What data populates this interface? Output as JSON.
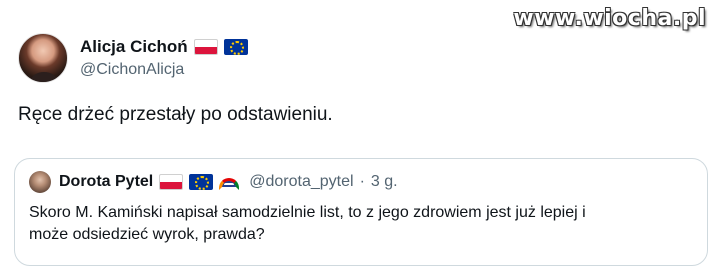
{
  "watermark": "www.wiocha.pl",
  "tweet": {
    "author": {
      "display_name": "Alicja Cichoń",
      "handle": "@CichonAlicja",
      "badges": [
        "flag-poland-icon",
        "flag-eu-icon"
      ]
    },
    "text": "Ręce drżeć przestały po odstawieniu."
  },
  "quoted_tweet": {
    "author": {
      "display_name": "Dorota Pytel",
      "handle": "@dorota_pytel",
      "badges": [
        "flag-poland-icon",
        "flag-eu-icon",
        "rainbow-icon"
      ]
    },
    "separator": "·",
    "time": "3 g.",
    "text_line_1": "Skoro M. Kamiński napisał samodzielnie list, to z jego zdrowiem jest już lepiej i",
    "text_line_2": "może odsiedzieć wyrok, prawda?"
  },
  "colors": {
    "text_primary": "#0f1419",
    "text_secondary": "#536471",
    "border": "#cfd9de"
  }
}
